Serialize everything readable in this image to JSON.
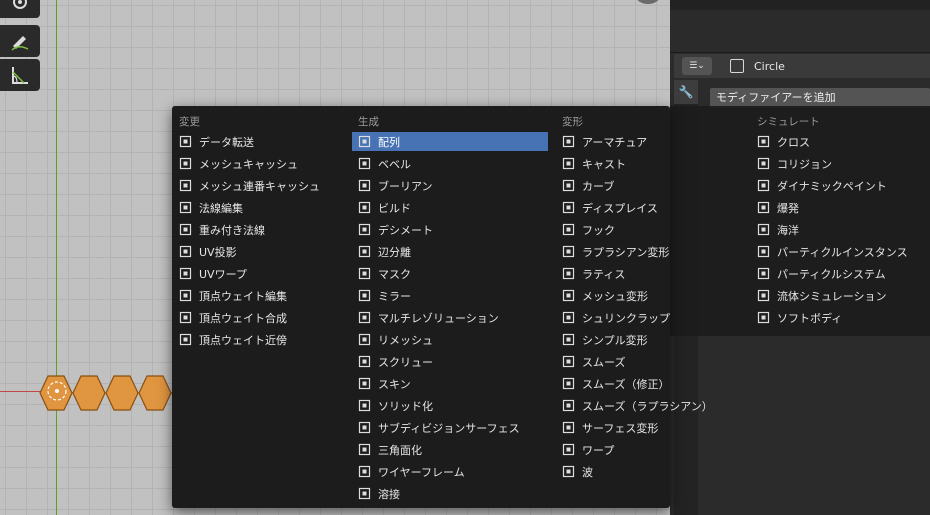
{
  "properties": {
    "object_name": "Circle",
    "add_modifier_label": "モディファイアーを追加"
  },
  "menu": {
    "columns": [
      {
        "title": "変更",
        "items": [
          {
            "label": "データ転送",
            "icon": "data-transfer-icon"
          },
          {
            "label": "メッシュキャッシュ",
            "icon": "mesh-cache-icon"
          },
          {
            "label": "メッシュ連番キャッシュ",
            "icon": "mesh-sequence-cache-icon"
          },
          {
            "label": "法線編集",
            "icon": "normal-edit-icon"
          },
          {
            "label": "重み付き法線",
            "icon": "weighted-normal-icon"
          },
          {
            "label": "UV投影",
            "icon": "uv-project-icon"
          },
          {
            "label": "UVワープ",
            "icon": "uv-warp-icon"
          },
          {
            "label": "頂点ウェイト編集",
            "icon": "vertex-weight-edit-icon"
          },
          {
            "label": "頂点ウェイト合成",
            "icon": "vertex-weight-mix-icon"
          },
          {
            "label": "頂点ウェイト近傍",
            "icon": "vertex-weight-proximity-icon"
          }
        ]
      },
      {
        "title": "生成",
        "items": [
          {
            "label": "配列",
            "icon": "array-icon",
            "highlighted": true
          },
          {
            "label": "ベベル",
            "icon": "bevel-icon"
          },
          {
            "label": "ブーリアン",
            "icon": "boolean-icon"
          },
          {
            "label": "ビルド",
            "icon": "build-icon"
          },
          {
            "label": "デシメート",
            "icon": "decimate-icon"
          },
          {
            "label": "辺分離",
            "icon": "edge-split-icon"
          },
          {
            "label": "マスク",
            "icon": "mask-icon"
          },
          {
            "label": "ミラー",
            "icon": "mirror-icon"
          },
          {
            "label": "マルチレゾリューション",
            "icon": "multires-icon"
          },
          {
            "label": "リメッシュ",
            "icon": "remesh-icon"
          },
          {
            "label": "スクリュー",
            "icon": "screw-icon"
          },
          {
            "label": "スキン",
            "icon": "skin-icon"
          },
          {
            "label": "ソリッド化",
            "icon": "solidify-icon"
          },
          {
            "label": "サブディビジョンサーフェス",
            "icon": "subsurf-icon"
          },
          {
            "label": "三角面化",
            "icon": "triangulate-icon"
          },
          {
            "label": "ワイヤーフレーム",
            "icon": "wireframe-icon"
          },
          {
            "label": "溶接",
            "icon": "weld-icon"
          }
        ]
      },
      {
        "title": "変形",
        "items": [
          {
            "label": "アーマチュア",
            "icon": "armature-icon"
          },
          {
            "label": "キャスト",
            "icon": "cast-icon"
          },
          {
            "label": "カーブ",
            "icon": "curve-icon"
          },
          {
            "label": "ディスプレイス",
            "icon": "displace-icon"
          },
          {
            "label": "フック",
            "icon": "hook-icon"
          },
          {
            "label": "ラプラシアン変形",
            "icon": "laplacian-deform-icon"
          },
          {
            "label": "ラティス",
            "icon": "lattice-icon"
          },
          {
            "label": "メッシュ変形",
            "icon": "mesh-deform-icon"
          },
          {
            "label": "シュリンクラップ",
            "icon": "shrinkwrap-icon"
          },
          {
            "label": "シンプル変形",
            "icon": "simple-deform-icon"
          },
          {
            "label": "スムーズ",
            "icon": "smooth-icon"
          },
          {
            "label": "スムーズ（修正）",
            "icon": "corrective-smooth-icon"
          },
          {
            "label": "スムーズ（ラプラシアン）",
            "icon": "laplacian-smooth-icon"
          },
          {
            "label": "サーフェス変形",
            "icon": "surface-deform-icon"
          },
          {
            "label": "ワープ",
            "icon": "warp-icon"
          },
          {
            "label": "波",
            "icon": "wave-icon"
          }
        ]
      },
      {
        "title": "シミュレート",
        "items": [
          {
            "label": "クロス",
            "icon": "cloth-icon"
          },
          {
            "label": "コリジョン",
            "icon": "collision-icon"
          },
          {
            "label": "ダイナミックペイント",
            "icon": "dynamic-paint-icon"
          },
          {
            "label": "爆発",
            "icon": "explode-icon"
          },
          {
            "label": "海洋",
            "icon": "ocean-icon"
          },
          {
            "label": "パーティクルインスタンス",
            "icon": "particle-instance-icon"
          },
          {
            "label": "パーティクルシステム",
            "icon": "particle-system-icon"
          },
          {
            "label": "流体シミュレーション",
            "icon": "fluid-icon"
          },
          {
            "label": "ソフトボディ",
            "icon": "soft-body-icon"
          }
        ]
      }
    ]
  },
  "colors": {
    "highlight": "#4772b3",
    "menu_bg": "#1c1c1c",
    "mesh_orange": "#e09540"
  }
}
